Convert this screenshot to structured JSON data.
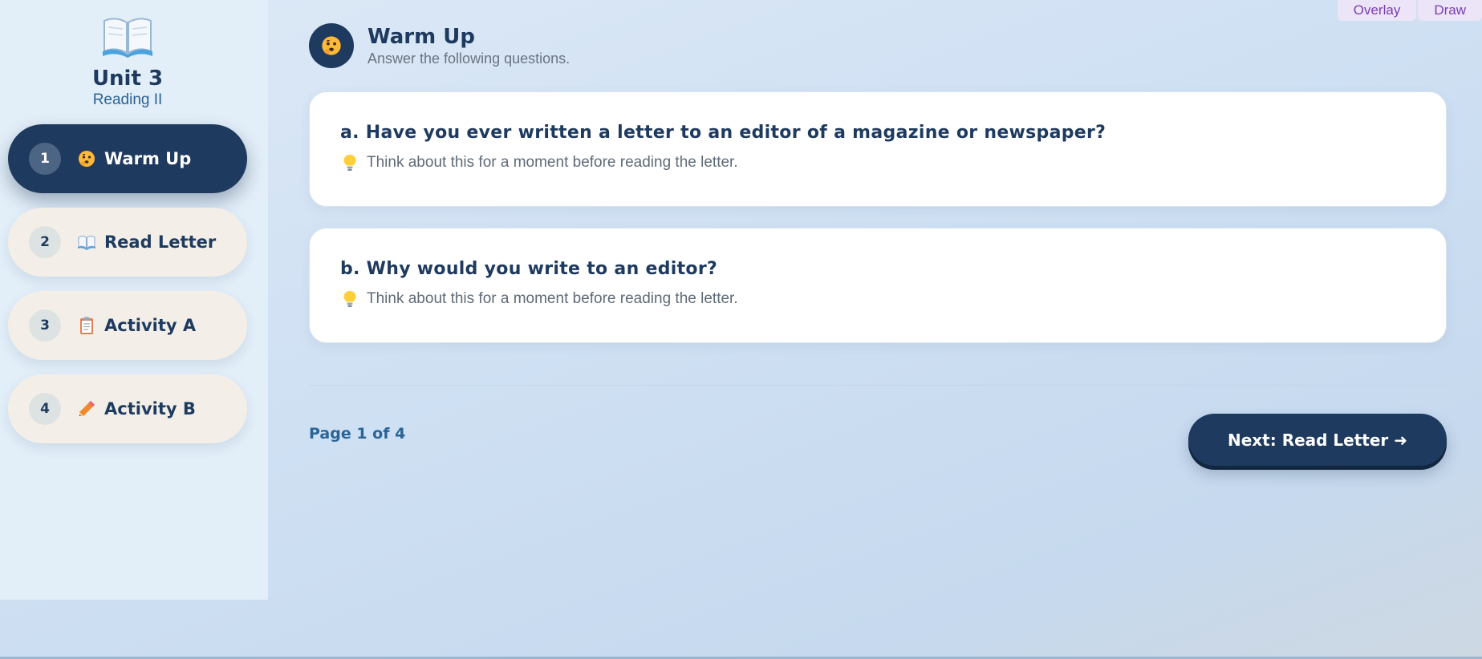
{
  "tools": {
    "overlay_label": "Overlay",
    "draw_label": "Draw"
  },
  "sidebar": {
    "brand_icon": "open-book-icon",
    "title": "Unit 3",
    "subtitle": "Reading II",
    "items": [
      {
        "num": "1",
        "icon": "thinking-face-icon",
        "label": "Warm Up",
        "active": true
      },
      {
        "num": "2",
        "icon": "open-book-icon",
        "label": "Read Letter",
        "active": false
      },
      {
        "num": "3",
        "icon": "clipboard-icon",
        "label": "Activity A",
        "active": false
      },
      {
        "num": "4",
        "icon": "pencil-icon",
        "label": "Activity B",
        "active": false
      }
    ]
  },
  "header": {
    "icon": "thinking-face-icon",
    "title": "Warm Up",
    "subtitle": "Answer the following questions."
  },
  "questions": [
    {
      "text": "a. Have you ever written a letter to an editor of a magazine or newspaper?",
      "hint_icon": "light-bulb-icon",
      "hint": "Think about this for a moment before reading the letter."
    },
    {
      "text": "b. Why would you write to an editor?",
      "hint_icon": "light-bulb-icon",
      "hint": "Think about this for a moment before reading the letter."
    }
  ],
  "footer": {
    "page_indicator": "Page 1 of 4",
    "next_label": "Next: Read Letter ➜"
  },
  "colors": {
    "primary": "#1f3a5f",
    "accent_text": "#2a6496",
    "tool_text": "#7a3fb0",
    "tool_bg": "#ece4f7"
  }
}
